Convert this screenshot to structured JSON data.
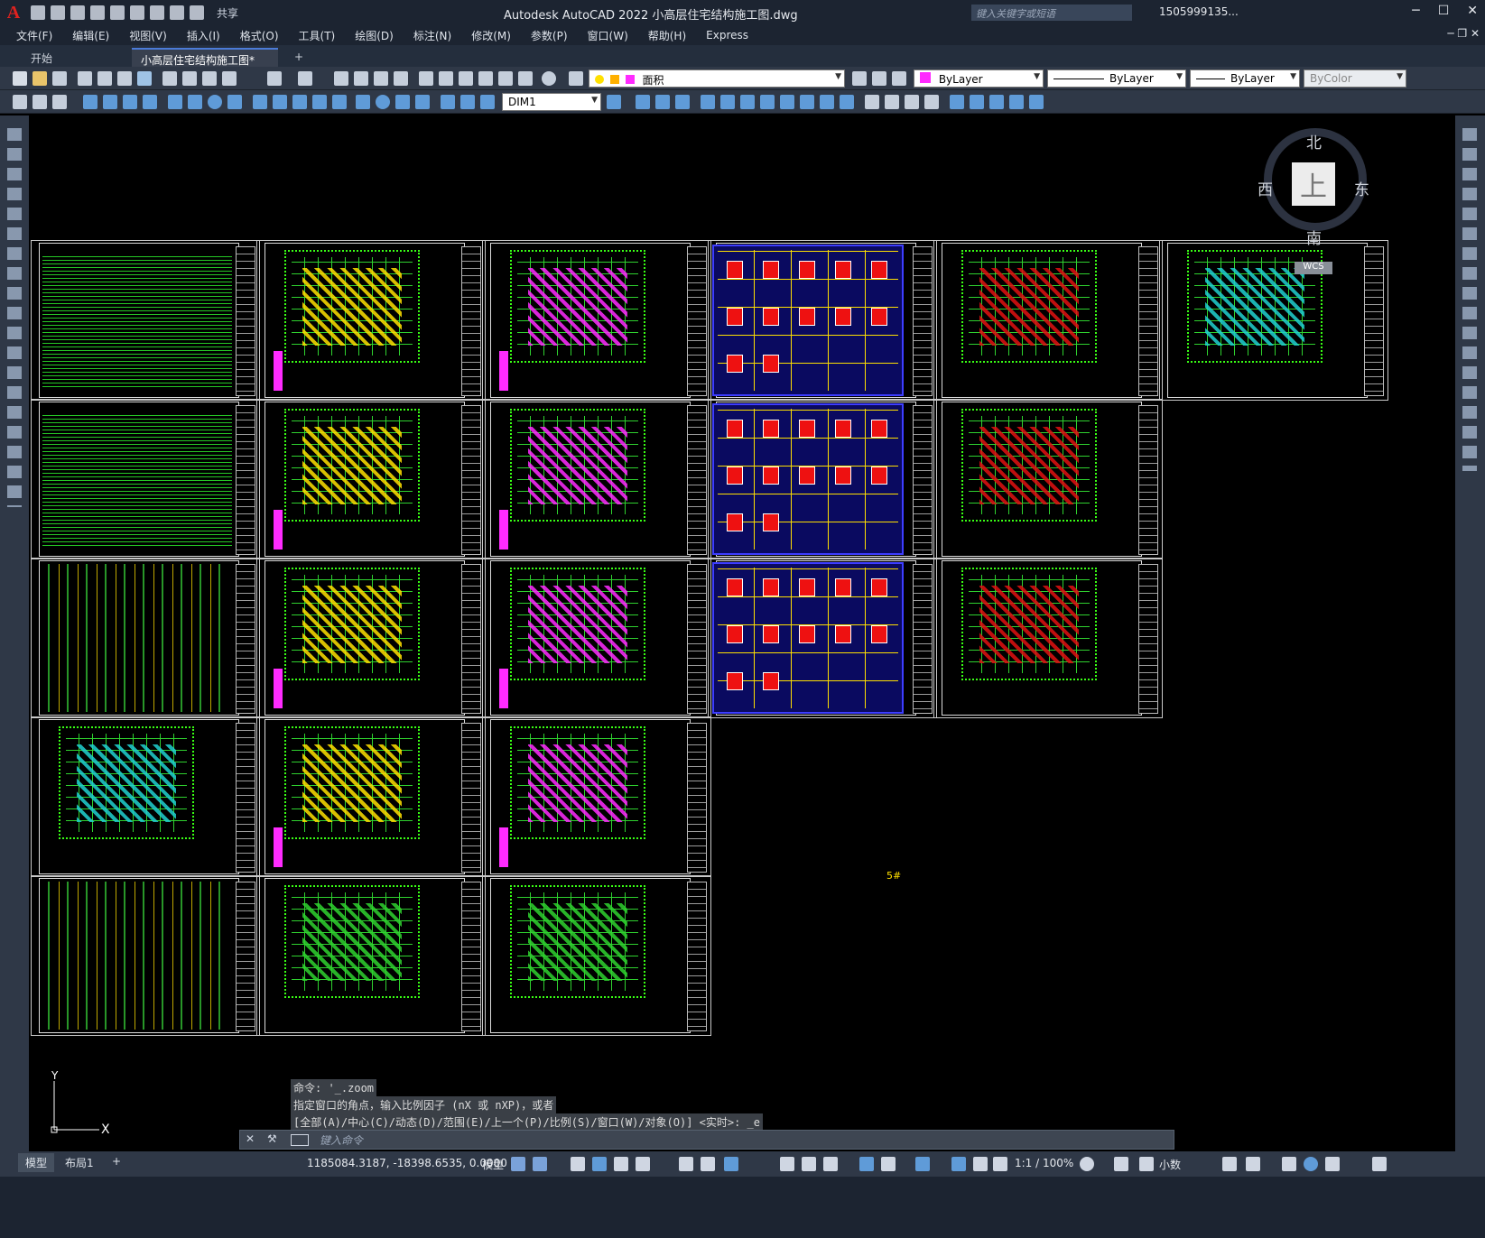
{
  "app": {
    "title": "Autodesk AutoCAD 2022    小高层住宅结构施工图.dwg",
    "share_label": "共享",
    "search_placeholder": "键入关键字或短语",
    "user": "1505999135...",
    "logo": "A"
  },
  "menu": [
    "文件(F)",
    "编辑(E)",
    "视图(V)",
    "插入(I)",
    "格式(O)",
    "工具(T)",
    "绘图(D)",
    "标注(N)",
    "修改(M)",
    "参数(P)",
    "窗口(W)",
    "帮助(H)",
    "Express"
  ],
  "tabs": {
    "start": "开始",
    "doc": "小高层住宅结构施工图*",
    "close": "✕",
    "add": "+"
  },
  "properties": {
    "layer": "面积",
    "color": "ByLayer",
    "linetype": "ByLayer",
    "lineweight": "ByLayer",
    "plotstyle": "ByColor",
    "dimstyle": "DIM1"
  },
  "viewcube": {
    "north": "北",
    "south": "南",
    "east": "东",
    "west": "西",
    "top": "上",
    "wcs": "WCS"
  },
  "canvas": {
    "marker": "5#",
    "ucs_x": "X",
    "ucs_y": "Y"
  },
  "command": {
    "history": [
      "命令: '_.zoom",
      "指定窗口的角点，输入比例因子 (nX 或 nXP)，或者",
      "[全部(A)/中心(C)/动态(D)/范围(E)/上一个(P)/比例(S)/窗口(W)/对象(O)] <实时>: _e"
    ],
    "placeholder": "键入命令"
  },
  "status": {
    "model_tab": "模型",
    "layout_tab": "布局1",
    "add_tab": "+",
    "coordinates": "1185084.3187, -18398.6535, 0.0000",
    "space": "模型",
    "scale": "1:1 / 100%",
    "units": "小数"
  },
  "colors": {
    "accent": "#4b7bd8",
    "green": "#2fd22f",
    "yellow": "#ffe000",
    "magenta": "#ff2bff",
    "red": "#e11111",
    "blue": "#3d3dff"
  }
}
